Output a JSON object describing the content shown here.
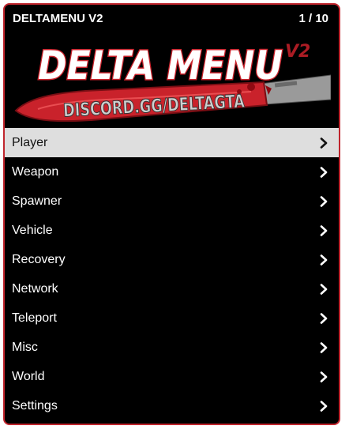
{
  "header": {
    "title": "DELTAMENU V2",
    "page_indicator": "1 / 10"
  },
  "banner": {
    "logo_text": "DELTA MENU",
    "version_text": "V2",
    "discord_text": "DISCORD.GG/DELTAGTA"
  },
  "menu": {
    "items": [
      {
        "label": "Player",
        "selected": true
      },
      {
        "label": "Weapon"
      },
      {
        "label": "Spawner"
      },
      {
        "label": "Vehicle"
      },
      {
        "label": "Recovery"
      },
      {
        "label": "Network"
      },
      {
        "label": "Teleport"
      },
      {
        "label": "Misc"
      },
      {
        "label": "World"
      },
      {
        "label": "Settings"
      }
    ]
  },
  "colors": {
    "background": "#000000",
    "border": "#c0252d",
    "selected_row": "#dedede",
    "text": "#ffffff",
    "logo_red": "#d1242c"
  },
  "icons": {
    "submenu_arrow": "chevron-right-icon"
  }
}
